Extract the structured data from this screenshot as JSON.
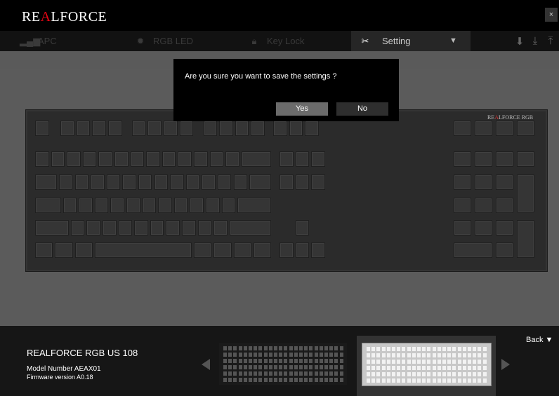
{
  "app": {
    "logo_pre": "RE",
    "logo_mid": "A",
    "logo_post": "LFORCE",
    "close": "×"
  },
  "tabs": [
    {
      "label": "APC",
      "icon": "apc-icon"
    },
    {
      "label": "RGB LED",
      "icon": "led-icon"
    },
    {
      "label": "Key Lock",
      "icon": "lock-icon"
    },
    {
      "label": "Setting",
      "icon": "tools-icon",
      "active": true
    }
  ],
  "tab_dropdown_arrow": "▼",
  "toolbar_icons": [
    "keyboard-download-icon",
    "download-icon",
    "upload-icon"
  ],
  "dialog": {
    "message": "Are you sure you want to save the settings ?",
    "yes": "Yes",
    "no": "No"
  },
  "keyboard": {
    "brand_pre": "RE",
    "brand_mid": "A",
    "brand_post": "LFORCE RGB"
  },
  "footer": {
    "product_name": "REALFORCE RGB US 108",
    "model": "Model Number AEAX01",
    "firmware": "Firmware version  A0.18",
    "back": "Back  ▼"
  },
  "colors": {
    "accent_red": "#e30613",
    "dialog_bg": "#000000",
    "yes_bg": "#6b6b6b",
    "no_bg": "#2e2e2e"
  }
}
